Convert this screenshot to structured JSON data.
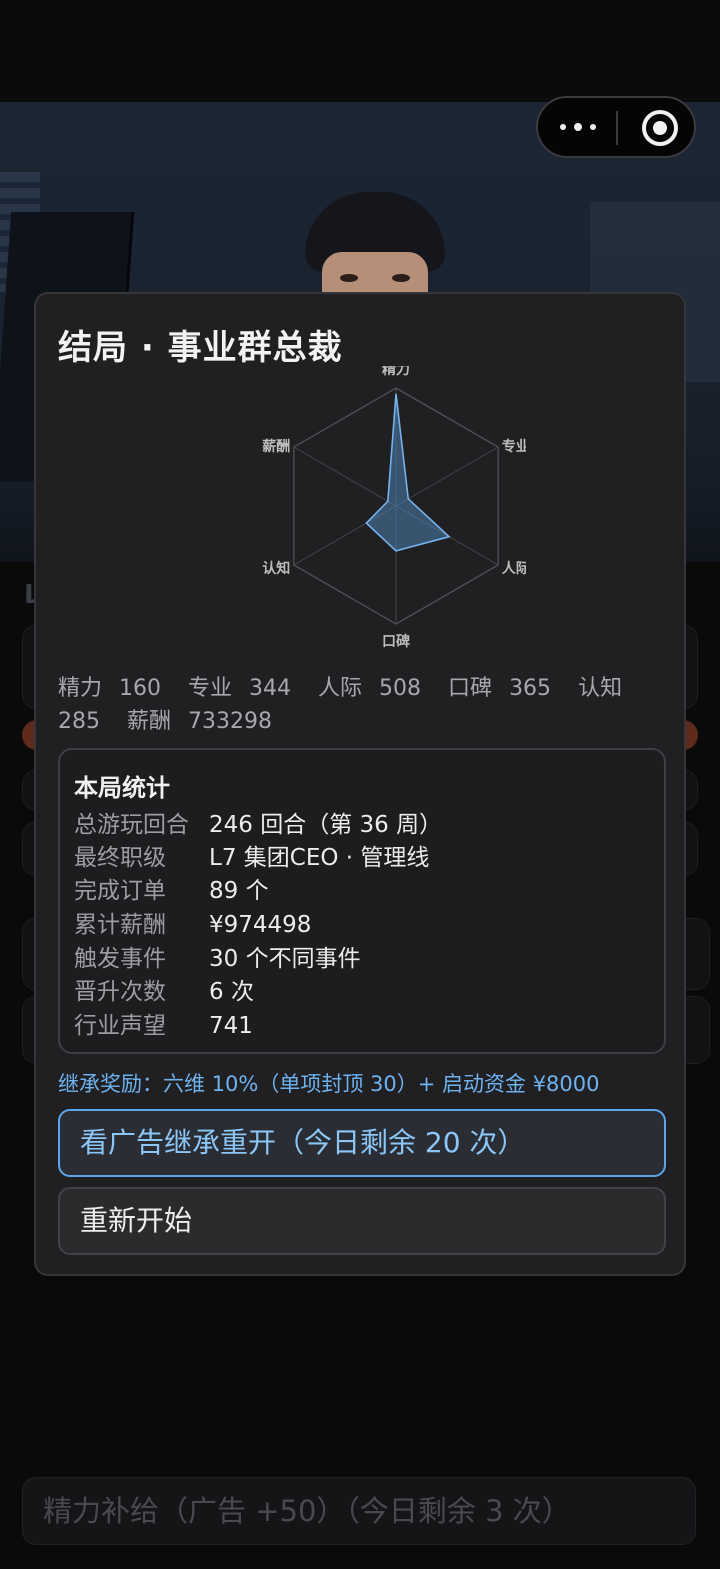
{
  "capsule": {
    "more_icon": "more-dots-icon",
    "close_icon": "target-circle-icon"
  },
  "background": {
    "energy_button_label": "精力补给（广告 +50）（今日剩余 3 次）"
  },
  "modal": {
    "title": "结局 · 事业群总裁",
    "radar": {
      "axes": [
        "精力",
        "专业",
        "人际",
        "口碑",
        "认知",
        "薪酬"
      ],
      "values": [
        160,
        344,
        508,
        365,
        285,
        733298
      ],
      "shown_fractions": [
        0.95,
        0.12,
        0.52,
        0.38,
        0.29,
        0.08
      ],
      "fill_color": "#4d7fae",
      "stroke_color": "#74b3ee"
    },
    "stats": [
      {
        "label": "精力",
        "value": "160"
      },
      {
        "label": "专业",
        "value": "344"
      },
      {
        "label": "人际",
        "value": "508"
      },
      {
        "label": "口碑",
        "value": "365"
      },
      {
        "label": "认知",
        "value": "285"
      },
      {
        "label": "薪酬",
        "value": "733298"
      }
    ],
    "summary": {
      "title": "本局统计",
      "rows": [
        {
          "key": "总游玩回合",
          "value": "246 回合（第 36 周）"
        },
        {
          "key": "最终职级",
          "value": "L7 集团CEO · 管理线"
        },
        {
          "key": "完成订单",
          "value": "89 个"
        },
        {
          "key": "累计薪酬",
          "value": "¥974498"
        },
        {
          "key": "触发事件",
          "value": "30 个不同事件"
        },
        {
          "key": "晋升次数",
          "value": "6 次"
        },
        {
          "key": "行业声望",
          "value": "741"
        }
      ]
    },
    "inherit_note": "继承奖励：六维 10%（单项封顶 30）+ 启动资金 ¥8000",
    "ad_button_label": "看广告继承重开（今日剩余 20 次）",
    "restart_button_label": "重新开始"
  }
}
